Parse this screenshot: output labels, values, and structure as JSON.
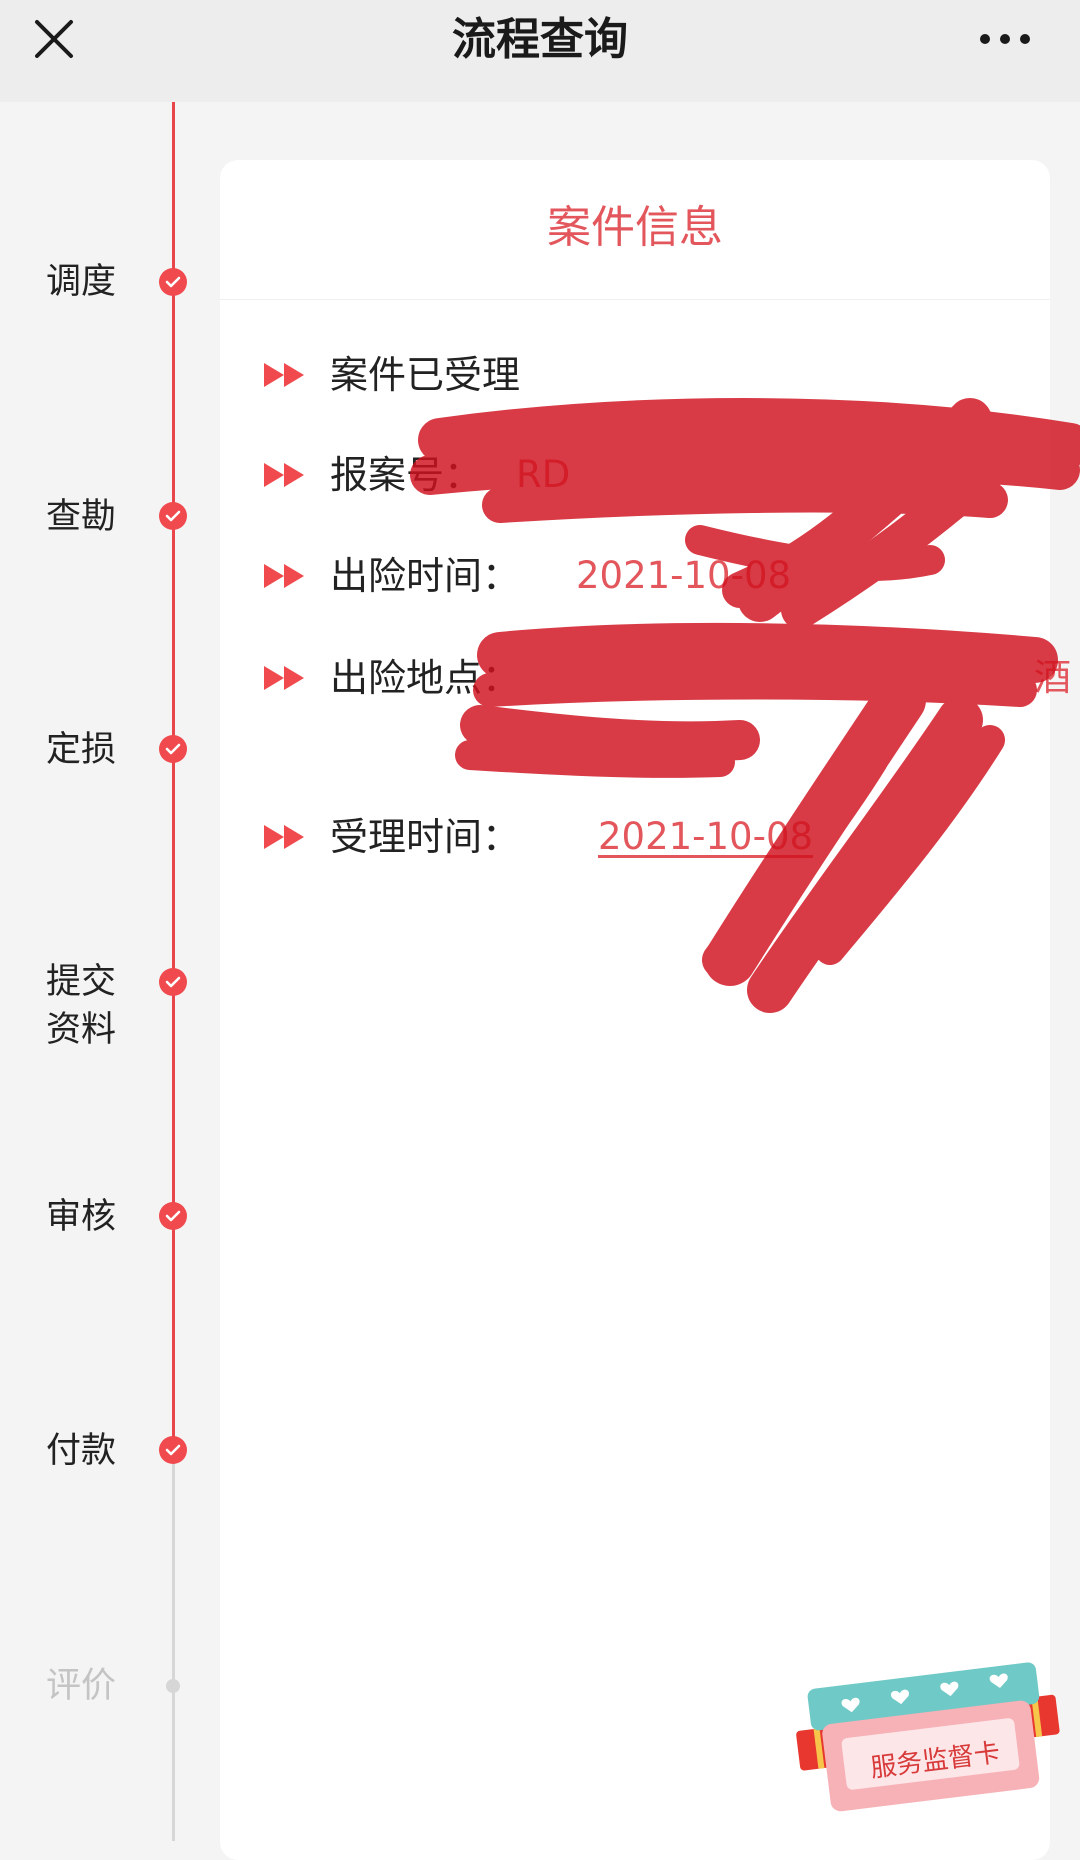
{
  "nav": {
    "title": "流程查询",
    "close_icon": "close-icon",
    "more_icon": "more-icon"
  },
  "timeline": {
    "steps": [
      {
        "label": "调度",
        "status": "done"
      },
      {
        "label": "查勘",
        "status": "done"
      },
      {
        "label": "定损",
        "status": "done"
      },
      {
        "label": "提交资料",
        "status": "done"
      },
      {
        "label": "审核",
        "status": "done"
      },
      {
        "label": "付款",
        "status": "done"
      },
      {
        "label": "评价",
        "status": "pending"
      }
    ],
    "colors": {
      "active": "#e9464c",
      "inactive": "#d6d6d6"
    }
  },
  "card": {
    "title": "案件信息",
    "rows": [
      {
        "label": "案件已受理",
        "value": ""
      },
      {
        "label": "报案号：",
        "value": "RD"
      },
      {
        "label": "出险时间：",
        "value": "2021-10-08"
      },
      {
        "label": "出险地点：",
        "value": "酒"
      },
      {
        "label": "受理时间：",
        "value": "2021-10-08"
      }
    ]
  },
  "service_card": {
    "label": "服务监督卡"
  },
  "colors": {
    "accent": "#e2565c",
    "redaction": "#d0111e"
  }
}
